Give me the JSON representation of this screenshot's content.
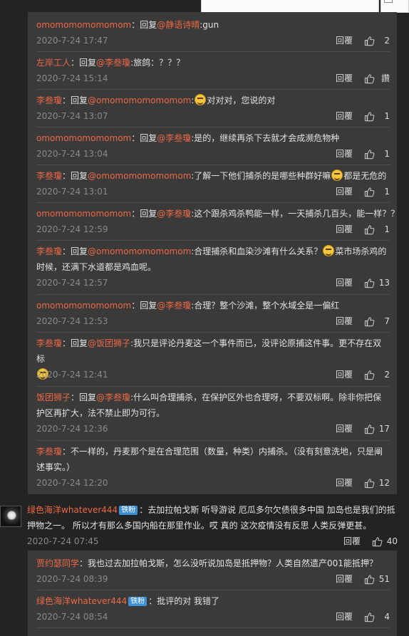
{
  "ui": {
    "reply_label": "回覆"
  },
  "replies": [
    {
      "user": "omomomomomomom",
      "mention": "静语诗晴",
      "text": ":gun",
      "date": "2020-7-24 17:47",
      "likes": "2"
    },
    {
      "user": "左岸工人",
      "mention": "李叁瓊",
      "text": ":旅鸽：？？？",
      "date": "2020-7-24 15:14",
      "likes": "讚"
    },
    {
      "user": "李叁瓊",
      "mention": "omomomomomomom",
      "text_a": ":",
      "text_b": "对对对，您说的对",
      "date": "2020-7-24 13:07",
      "likes": "1"
    },
    {
      "user": "omomomomomomom",
      "mention": "李叁瓊",
      "text": ":是的，继续再杀下去就才会成濒危物种",
      "date": "2020-7-24 13:04",
      "likes": "1"
    },
    {
      "user": "李叁瓊",
      "mention": "omomomomomomom",
      "text_a": ":了解一下他们捕杀的是哪些种群好嘛",
      "text_b": "都是无危的",
      "date": "2020-7-24 13:01",
      "likes": "1"
    },
    {
      "user": "omomomomomomom",
      "mention": "李叁瓊",
      "text": ":这个跟杀鸡杀鸭能一样，一天捕杀几百头，能一样？？",
      "date": "2020-7-24 12:59",
      "likes": "1"
    },
    {
      "user": "李叁瓊",
      "mention": "omomomomomomom",
      "text_a": ":合理捕杀和血染沙滩有什么关系？",
      "text_b": "菜市场杀鸡的时候，还满下水道都是鸡血呢。",
      "date": "2020-7-24 12:57",
      "likes": "13"
    },
    {
      "user": "omomomomomomom",
      "mention": "李叁瓊",
      "text": ":合理？整个沙滩，整个水域全是一偏红",
      "date": "2020-7-24 12:53",
      "likes": "7"
    },
    {
      "user": "李叁瓊",
      "mention": "饭团狮子",
      "text_a": ":我只是评论丹麦这一个事件而已，没评论原捕这件事。更不存在双标",
      "text_b": "",
      "date": "2020-7-24 12:41",
      "likes": "2"
    },
    {
      "user": "饭团狮子",
      "mention": "李叁瓊",
      "text": ":什么叫合理捕杀，在保护区外也合理呀，不要双标啊。除非你把保护区再扩大，法不禁止即为可行。",
      "date": "2020-7-24 12:36",
      "likes": "17"
    },
    {
      "user": "李叁瓊",
      "text": "不一样的，丹麦那个是在合理范围（数量，种类）内捕杀。（没有刻意洗地，只是阐述事实。）",
      "date": "2020-7-24 12:20",
      "likes": "12"
    }
  ],
  "main_comment": {
    "user": "绿色海洋whatever444",
    "badge": "铁粉",
    "text": "去加拉帕戈斯 听导游说 厄瓜多尔欠债很多中国 加岛也是我们的抵押物之一。 所以才有那么多国内船在那里作业。哎 真的 这次疫情没有反思  人类反弹更甚。",
    "date": "2020-7-24 07:45",
    "likes": "40"
  },
  "sub_replies": [
    {
      "user": "贾约瑟同学",
      "text": "我也过去加拉帕戈斯，怎么没听说加岛是抵押物？人类自然遗产001能抵押？",
      "date": "2020-7-24 08:39",
      "likes": "51"
    },
    {
      "user": "绿色海洋whatever444",
      "badge": "铁粉",
      "text": "批评的对 我错了",
      "date": "2020-7-24 08:54",
      "likes": "4"
    }
  ],
  "labels": {
    "reply_prefix": "回复",
    "at": "@",
    "colon": "："
  },
  "colors": {
    "username": "#ee6845",
    "badge": "#3d8fd6",
    "panel": "#3a3a3a",
    "page": "#232323"
  },
  "icons": [
    "thumbs-up-icon",
    "emoji-smile-icon",
    "avatar-image"
  ]
}
